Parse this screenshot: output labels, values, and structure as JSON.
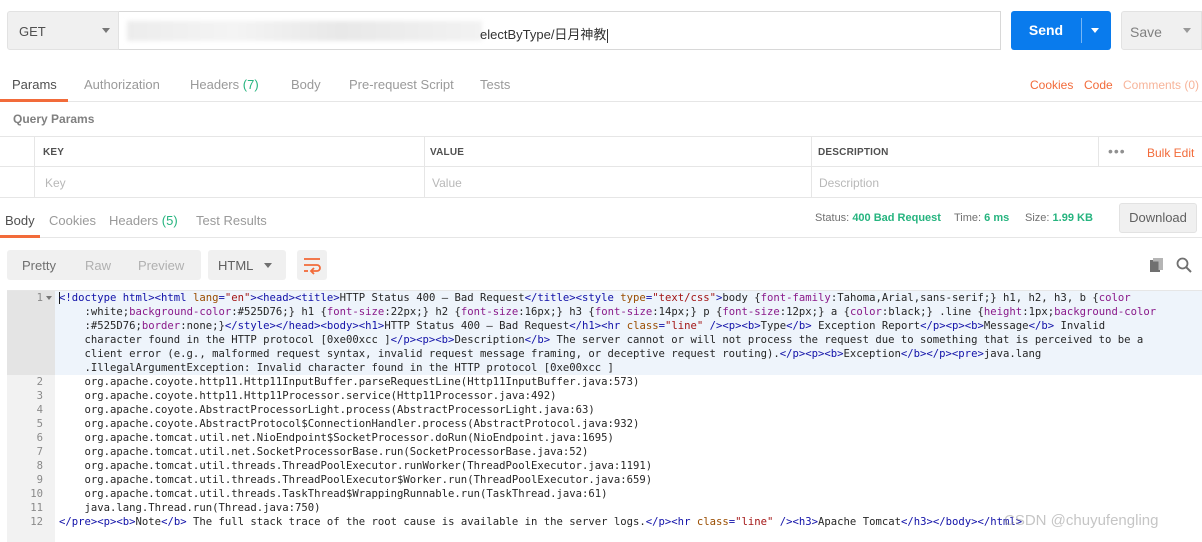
{
  "request": {
    "method": "GET",
    "url_visible": "electByType/日月神教",
    "send_label": "Send",
    "save_label": "Save"
  },
  "request_tabs": [
    {
      "label": "Params",
      "count": ""
    },
    {
      "label": "Authorization",
      "count": ""
    },
    {
      "label": "Headers",
      "count": "(7)"
    },
    {
      "label": "Body",
      "count": ""
    },
    {
      "label": "Pre-request Script",
      "count": ""
    },
    {
      "label": "Tests",
      "count": ""
    }
  ],
  "request_links": {
    "cookies": "Cookies",
    "code": "Code",
    "comments": "Comments (0)"
  },
  "query_params": {
    "title": "Query Params",
    "headers": {
      "key": "KEY",
      "value": "VALUE",
      "description": "DESCRIPTION"
    },
    "placeholders": {
      "key": "Key",
      "value": "Value",
      "description": "Description"
    },
    "more": "•••",
    "bulk_edit": "Bulk Edit"
  },
  "response_tabs": [
    {
      "label": "Body",
      "count": ""
    },
    {
      "label": "Cookies",
      "count": ""
    },
    {
      "label": "Headers",
      "count": "(5)"
    },
    {
      "label": "Test Results",
      "count": ""
    }
  ],
  "response_meta": {
    "status_label": "Status:",
    "status_value": "400 Bad Request",
    "time_label": "Time:",
    "time_value": "6 ms",
    "size_label": "Size:",
    "size_value": "1.99 KB",
    "download": "Download"
  },
  "view_modes": {
    "pretty": "Pretty",
    "raw": "Raw",
    "preview": "Preview",
    "format": "HTML"
  },
  "code_lines": [
    {
      "num": "1",
      "parts": [
        [
          "t",
          "<!doctype html><html "
        ],
        [
          "an",
          "lang"
        ],
        [
          "t",
          "="
        ],
        [
          "av",
          "\"en\""
        ],
        [
          "t",
          "><head><title>"
        ],
        [
          "x",
          "HTTP Status 400 – Bad Request"
        ],
        [
          "t",
          "</title><style "
        ],
        [
          "an",
          "type"
        ],
        [
          "t",
          "="
        ],
        [
          "av",
          "\"text/css\""
        ],
        [
          "t",
          ">"
        ],
        [
          "x",
          "body {"
        ],
        [
          "cm",
          "font-family"
        ],
        [
          "x",
          ":Tahoma,Arial,sans-serif;} h1, h2, h3, b {"
        ],
        [
          "cm",
          "color"
        ]
      ]
    },
    {
      "num": "",
      "parts": [
        [
          "x",
          "    :white;"
        ],
        [
          "cm",
          "background-color"
        ],
        [
          "x",
          ":#525D76;} h1 {"
        ],
        [
          "cm",
          "font-size"
        ],
        [
          "x",
          ":22px;} h2 {"
        ],
        [
          "cm",
          "font-size"
        ],
        [
          "x",
          ":16px;} h3 {"
        ],
        [
          "cm",
          "font-size"
        ],
        [
          "x",
          ":14px;} p {"
        ],
        [
          "cm",
          "font-size"
        ],
        [
          "x",
          ":12px;} a {"
        ],
        [
          "cm",
          "color"
        ],
        [
          "x",
          ":black;} .line {"
        ],
        [
          "cm",
          "height"
        ],
        [
          "x",
          ":1px;"
        ],
        [
          "cm",
          "background-color"
        ]
      ]
    },
    {
      "num": "",
      "parts": [
        [
          "x",
          "    :#525D76;"
        ],
        [
          "cm",
          "border"
        ],
        [
          "x",
          ":none;}"
        ],
        [
          "t",
          "</style></head><body><h1>"
        ],
        [
          "x",
          "HTTP Status 400 – Bad Request"
        ],
        [
          "t",
          "</h1><hr "
        ],
        [
          "an",
          "class"
        ],
        [
          "t",
          "="
        ],
        [
          "av",
          "\"line\""
        ],
        [
          "t",
          " /><p><b>"
        ],
        [
          "x",
          "Type"
        ],
        [
          "t",
          "</b>"
        ],
        [
          "x",
          " Exception Report"
        ],
        [
          "t",
          "</p><p><b>"
        ],
        [
          "x",
          "Message"
        ],
        [
          "t",
          "</b>"
        ],
        [
          "x",
          " Invalid"
        ]
      ]
    },
    {
      "num": "",
      "parts": [
        [
          "x",
          "    character found in the HTTP protocol [0xe00xcc ]"
        ],
        [
          "t",
          "</p><p><b>"
        ],
        [
          "x",
          "Description"
        ],
        [
          "t",
          "</b>"
        ],
        [
          "x",
          " The server cannot or will not process the request due to something that is perceived to be a"
        ]
      ]
    },
    {
      "num": "",
      "parts": [
        [
          "x",
          "    client error (e.g., malformed request syntax, invalid request message framing, or deceptive request routing)."
        ],
        [
          "t",
          "</p><p><b>"
        ],
        [
          "x",
          "Exception"
        ],
        [
          "t",
          "</b></p><pre>"
        ],
        [
          "x",
          "java.lang"
        ]
      ]
    },
    {
      "num": "",
      "parts": [
        [
          "x",
          "    .IllegalArgumentException: Invalid character found in the HTTP protocol [0xe00xcc ]"
        ]
      ]
    },
    {
      "num": "2",
      "parts": [
        [
          "x",
          "    org.apache.coyote.http11.Http11InputBuffer.parseRequestLine(Http11InputBuffer.java:573)"
        ]
      ]
    },
    {
      "num": "3",
      "parts": [
        [
          "x",
          "    org.apache.coyote.http11.Http11Processor.service(Http11Processor.java:492)"
        ]
      ]
    },
    {
      "num": "4",
      "parts": [
        [
          "x",
          "    org.apache.coyote.AbstractProcessorLight.process(AbstractProcessorLight.java:63)"
        ]
      ]
    },
    {
      "num": "5",
      "parts": [
        [
          "x",
          "    org.apache.coyote.AbstractProtocol$ConnectionHandler.process(AbstractProtocol.java:932)"
        ]
      ]
    },
    {
      "num": "6",
      "parts": [
        [
          "x",
          "    org.apache.tomcat.util.net.NioEndpoint$SocketProcessor.doRun(NioEndpoint.java:1695)"
        ]
      ]
    },
    {
      "num": "7",
      "parts": [
        [
          "x",
          "    org.apache.tomcat.util.net.SocketProcessorBase.run(SocketProcessorBase.java:52)"
        ]
      ]
    },
    {
      "num": "8",
      "parts": [
        [
          "x",
          "    org.apache.tomcat.util.threads.ThreadPoolExecutor.runWorker(ThreadPoolExecutor.java:1191)"
        ]
      ]
    },
    {
      "num": "9",
      "parts": [
        [
          "x",
          "    org.apache.tomcat.util.threads.ThreadPoolExecutor$Worker.run(ThreadPoolExecutor.java:659)"
        ]
      ]
    },
    {
      "num": "10",
      "parts": [
        [
          "x",
          "    org.apache.tomcat.util.threads.TaskThread$WrappingRunnable.run(TaskThread.java:61)"
        ]
      ]
    },
    {
      "num": "11",
      "parts": [
        [
          "x",
          "    java.lang.Thread.run(Thread.java:750)"
        ]
      ]
    },
    {
      "num": "12",
      "parts": [
        [
          "t",
          "</pre><p><b>"
        ],
        [
          "x",
          "Note"
        ],
        [
          "t",
          "</b>"
        ],
        [
          "x",
          " The full stack trace of the root cause is available in the server logs."
        ],
        [
          "t",
          "</p><hr "
        ],
        [
          "an",
          "class"
        ],
        [
          "t",
          "="
        ],
        [
          "av",
          "\"line\""
        ],
        [
          "t",
          " /><h3>"
        ],
        [
          "x",
          "Apache Tomcat"
        ],
        [
          "t",
          "</h3></body></html>"
        ]
      ]
    }
  ],
  "watermark": "CSDN @chuyufengling",
  "colors": {
    "send_blue": "#097bed",
    "accent_orange": "#f26b3a",
    "status_green": "#26b47f"
  },
  "icons": [
    "chevron-down-icon",
    "wrap-lines-icon",
    "copy-icon",
    "search-icon"
  ]
}
